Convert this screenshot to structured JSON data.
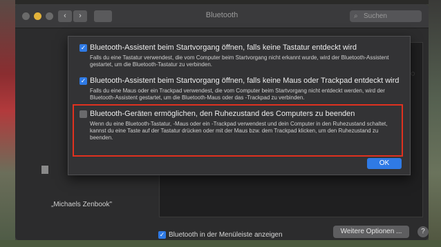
{
  "window": {
    "title": "Bluetooth",
    "search_placeholder": "Suchen",
    "nav_back": "‹",
    "nav_forward": "›"
  },
  "sheet": {
    "options": [
      {
        "label": "Bluetooth-Assistent beim Startvorgang öffnen, falls keine Tastatur entdeckt wird",
        "checked": true,
        "description": "Falls du eine Tastatur verwendest, die vom Computer beim Startvorgang nicht erkannt wurde, wird der Bluetooth-Assistent gestartet, um die Bluetooth-Tastatur zu verbinden."
      },
      {
        "label": "Bluetooth-Assistent beim Startvorgang öffnen, falls keine Maus oder Trackpad entdeckt wird",
        "checked": true,
        "description": "Falls du eine Maus oder ein Trackpad verwendest, die vom Computer beim Startvorgang nicht entdeckt werden, wird der Bluetooth-Assistent gestartet, um die Bluetooth-Maus oder das -Trackpad zu verbinden."
      },
      {
        "label": "Bluetooth-Geräten ermöglichen, den Ruhezustand des Computers zu beenden",
        "checked": false,
        "description": "Wenn du eine Bluetooth-Tastatur, -Maus oder ein -Trackpad verwendest und dein Computer in den Ruhezustand schaltet, kannst du eine Taste auf der Tastatur drücken oder mit der Maus bzw. dem Trackpad klicken, um den Ruhezustand zu beenden."
      }
    ],
    "ok_label": "OK"
  },
  "main": {
    "device_name": "„Michaels Zenbook\"",
    "show_in_menubar_label": "Bluetooth in der Menüleiste anzeigen",
    "show_in_menubar_checked": true,
    "more_options_label": "Weitere Optionen ...",
    "help_label": "?"
  },
  "colors": {
    "accent": "#2f7ae5",
    "highlight": "#e0311f"
  }
}
